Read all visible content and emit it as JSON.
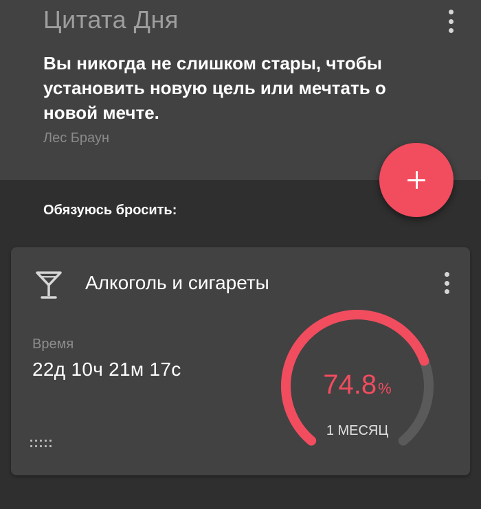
{
  "quote": {
    "title": "Цитата Дня",
    "text": "Вы никогда не слишком стары, чтобы установить новую цель или мечтать о новой мечте.",
    "author": "Лес Браун",
    "menu_icon": "more-vert-icon"
  },
  "fab": {
    "icon": "plus-icon",
    "color": "#f24c5f"
  },
  "section_label": "Обязуюсь бросить:",
  "habit": {
    "icon": "cocktail-glass-icon",
    "title": "Алкоголь и сигареты",
    "menu_icon": "more-vert-icon",
    "time_label": "Время",
    "time_value": "22д 10ч 21м 17с",
    "progress_fraction": 0.748,
    "percent_value": "74.8",
    "percent_symbol": "%",
    "goal_label": "1 МЕСЯЦ",
    "drag_icon": "drag-handle-icon"
  },
  "colors": {
    "accent": "#f24c5f",
    "background": "#2f2f2f",
    "card": "#424242",
    "track": "#5a5a5a"
  }
}
